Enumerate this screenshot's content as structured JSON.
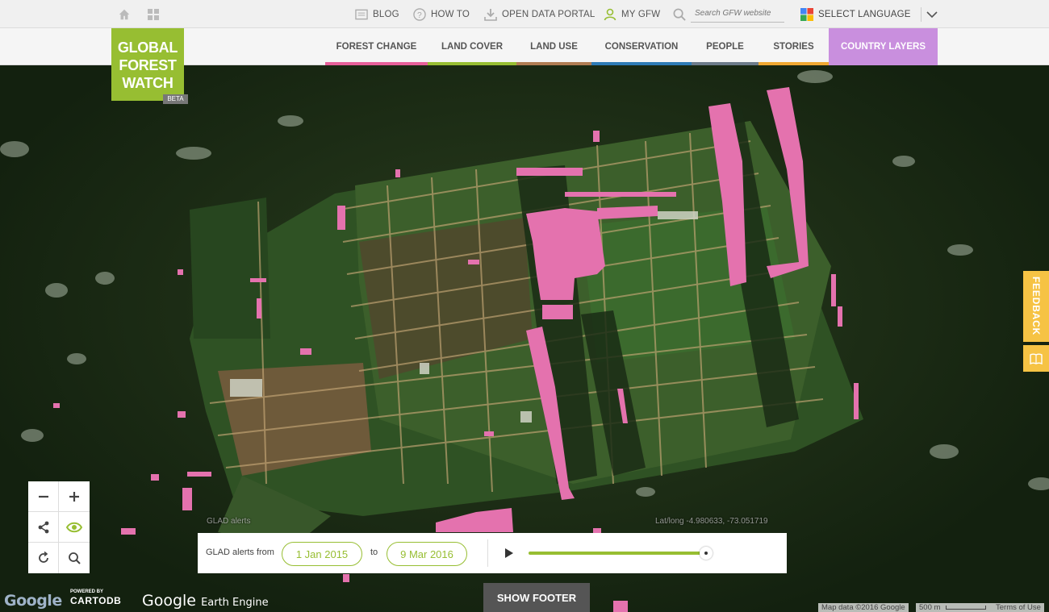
{
  "topbar": {
    "blog": "BLOG",
    "how_to": "HOW TO",
    "open_data": "OPEN DATA PORTAL",
    "my_gfw": "MY GFW",
    "search_placeholder": "Search GFW website",
    "language": "SELECT LANGUAGE"
  },
  "logo": {
    "line1": "GLOBAL",
    "line2": "FOREST",
    "line3": "WATCH",
    "badge": "BETA"
  },
  "nav": {
    "tabs": [
      {
        "label": "FOREST CHANGE",
        "color": "#e75f9a"
      },
      {
        "label": "LAND COVER",
        "color": "#97be32"
      },
      {
        "label": "LAND USE",
        "color": "#b07c53"
      },
      {
        "label": "CONSERVATION",
        "color": "#2e7bb6"
      },
      {
        "label": "PEOPLE",
        "color": "#6d7b8a"
      },
      {
        "label": "STORIES",
        "color": "#f0a832"
      },
      {
        "label": "COUNTRY LAYERS",
        "color": "#c98fde"
      }
    ]
  },
  "map": {
    "layer_label": "GLAD alerts",
    "latlong_label": "Lat/long",
    "latlong_value": "-4.980633, -73.051719",
    "alert_color": "#e472ae"
  },
  "controls": {
    "zoom_out": "zoom-out-icon",
    "zoom_in": "zoom-in-icon",
    "share": "share-icon",
    "toggle": "eye-icon",
    "reset": "refresh-icon",
    "search": "search-icon"
  },
  "timeline": {
    "label": "GLAD alerts from",
    "start_date": "1 Jan 2015",
    "to": "to",
    "end_date": "9 Mar 2016",
    "progress": 1.0
  },
  "footer": {
    "show_footer": "SHOW FOOTER",
    "google": "Google",
    "powered_by": "POWERED BY",
    "cartodb": "CARTODB",
    "earth_engine_google": "Google",
    "earth_engine": "Earth Engine",
    "map_data": "Map data ©2016 Google",
    "scale": "500 m",
    "terms": "Terms of Use"
  },
  "feedback": {
    "label": "FEEDBACK"
  }
}
